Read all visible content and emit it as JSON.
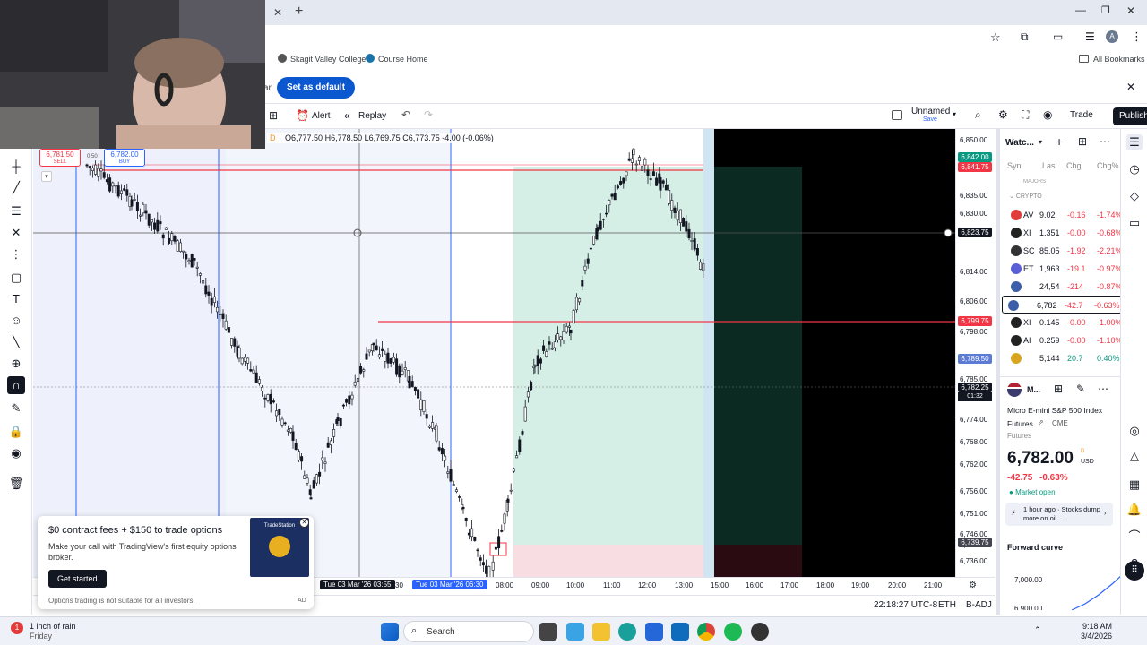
{
  "browser": {
    "bookmarks": [
      "Skagit Valley College",
      "Course Home"
    ],
    "all_bookmarks": "All Bookmarks",
    "bar_partial": "ar",
    "set_default": "Set as default"
  },
  "toolbar": {
    "alert": "Alert",
    "replay": "Replay",
    "layout_name": "Unnamed",
    "layout_sub": "Save",
    "trade": "Trade",
    "publish": "Publish"
  },
  "ohlc": {
    "interval": "D",
    "open": "O6,777.50",
    "high": "H6,778.50",
    "low": "L6,769.75",
    "close": "C6,773.75",
    "change": "-4.00 (-0.06%)"
  },
  "trade_buttons": {
    "sell_price": "6,781.50",
    "sell_label": "SELL",
    "spread": "0.50",
    "buy_price": "6,782.00",
    "buy_label": "BUY"
  },
  "price_axis": {
    "ticks": [
      "6,850.00",
      "6,835.00",
      "6,830.00",
      "6,814.00",
      "6,806.00",
      "6,798.00",
      "6,785.00",
      "6,774.00",
      "6,768.00",
      "6,762.00",
      "6,756.00",
      "6,751.00",
      "6,746.00",
      "6,741.00",
      "6,736.00"
    ],
    "tags": [
      {
        "value": "6,842.00",
        "color": "#089981"
      },
      {
        "value": "6,841.75",
        "color": "#f23645"
      },
      {
        "value": "6,823.75",
        "color": "#131722"
      },
      {
        "value": "6,799.75",
        "color": "#f23645"
      },
      {
        "value": "6,789.50",
        "color": "#5b7bd5"
      },
      {
        "value": "6,782.25",
        "color": "#131722",
        "sub": "01:32"
      },
      {
        "value": "6,739.75",
        "color": "#434651"
      }
    ]
  },
  "time_axis": {
    "labels": [
      "08:00",
      "09:00",
      "10:00",
      "11:00",
      "12:00",
      "13:00",
      "15:00",
      "16:00",
      "17:00",
      "18:00",
      "19:00",
      "20:00",
      "21:00"
    ],
    "cursor1_date": "Tue 03 Mar '26",
    "cursor1_time": "03:55",
    "cursor1_extra": "30",
    "cursor2": "Tue 03 Mar '26   06:30"
  },
  "watchlist": {
    "title": "Watc...",
    "columns": [
      "Syn",
      "Las",
      "Chg",
      "Chg%"
    ],
    "section_prev": "MAJORS",
    "section": "CRYPTO",
    "rows": [
      {
        "sym": "AV",
        "last": "9.02",
        "chg": "-0.16",
        "pct": "-1.74%",
        "color": "#e03c3c"
      },
      {
        "sym": "XI",
        "last": "1.351",
        "chg": "-0.00",
        "pct": "-0.68%",
        "color": "#222"
      },
      {
        "sym": "SC",
        "last": "85.05",
        "chg": "-1.92",
        "pct": "-2.21%",
        "color": "#333"
      },
      {
        "sym": "ET",
        "last": "1,963",
        "chg": "-19.1",
        "pct": "-0.97%",
        "color": "#5b5fd6"
      },
      {
        "sym": "",
        "last": "24,54",
        "chg": "-214",
        "pct": "-0.87%",
        "color": "#3c5ea8"
      },
      {
        "sym": "",
        "last": "6,782",
        "chg": "-42.7",
        "pct": "-0.63%",
        "color": "#3c5ea8"
      },
      {
        "sym": "XI",
        "last": "0.145",
        "chg": "-0.00",
        "pct": "-1.00%",
        "color": "#222"
      },
      {
        "sym": "AI",
        "last": "0.259",
        "chg": "-0.00",
        "pct": "-1.10%",
        "color": "#222"
      },
      {
        "sym": "",
        "last": "5,144",
        "chg": "20.7",
        "pct": "0.40%",
        "color": "#d9a520"
      }
    ],
    "detail": {
      "symbol_short": "M...",
      "name": "Micro E-mini S&P 500 Index Futures",
      "exchange": "CME",
      "category": "Futures",
      "price": "6,782.00",
      "price_flag": "D",
      "currency": "USD",
      "change": "-42.75",
      "change_pct": "-0.63%",
      "status": "Market open",
      "news_time": "1 hour ago",
      "news": "· Stocks dump more on oil...",
      "forward_curve": "Forward curve",
      "fc_ticks": [
        "7,000.00",
        "6,900.00"
      ]
    }
  },
  "promo": {
    "title": "$0 contract fees + $150 to trade options",
    "body": "Make your call with TradingView's first equity options broker.",
    "cta": "Get started",
    "disclaimer": "Options trading is not suitable for all investors.",
    "ad": "AD",
    "badge_brand": "TradeStation"
  },
  "status": {
    "clock": "22:18:27 UTC-8",
    "pair": "ETH",
    "adj": "B-ADJ"
  },
  "taskbar": {
    "weather": "1 inch of rain",
    "day": "Friday",
    "search": "Search",
    "time": "9:18 AM",
    "date": "3/4/2026"
  },
  "colors": {
    "accent": "#2962ff",
    "up": "#089981",
    "down": "#f23645",
    "publish_bg": "#131722"
  }
}
